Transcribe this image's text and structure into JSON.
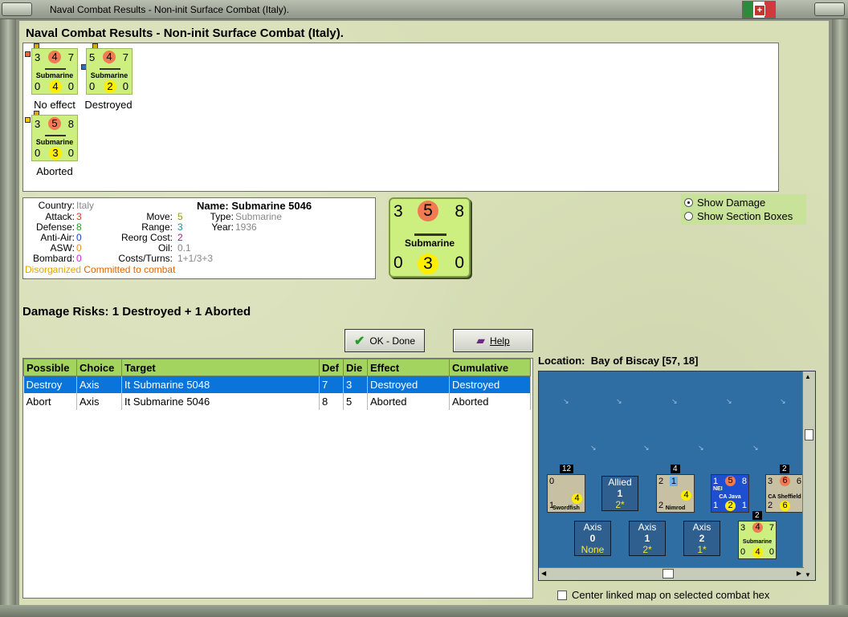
{
  "window": {
    "title": "Naval Combat Results - Non-init Surface Combat (Italy)."
  },
  "header": {
    "title": "Naval Combat Results - Non-init Surface Combat (Italy)."
  },
  "counters": [
    {
      "attack": "3",
      "defense_top": "4",
      "move": "7",
      "name": "Submarine",
      "bl": "0",
      "bc": "4",
      "br": "0",
      "result": "No effect"
    },
    {
      "attack": "5",
      "defense_top": "4",
      "move": "7",
      "name": "Submarine",
      "bl": "0",
      "bc": "2",
      "br": "0",
      "result": "Destroyed"
    },
    {
      "attack": "3",
      "defense_top": "5",
      "move": "8",
      "name": "Submarine",
      "bl": "0",
      "bc": "3",
      "br": "0",
      "result": "Aborted"
    }
  ],
  "info": {
    "country_label": "Country:",
    "country": "Italy",
    "attack_label": "Attack:",
    "attack": "3",
    "defense_label": "Defense:",
    "defense": "8",
    "antiair_label": "Anti-Air:",
    "antiair": "0",
    "asw_label": "ASW:",
    "asw": "0",
    "bombard_label": "Bombard:",
    "bombard": "0",
    "move_label": "Move:",
    "move": "5",
    "range_label": "Range:",
    "range": "3",
    "reorg_label": "Reorg Cost:",
    "reorg": "2",
    "oil_label": "Oil:",
    "oil": "0.1",
    "costs_label": "Costs/Turns:",
    "costs": "1+1/3+3",
    "name_label": "Name:",
    "name": "Submarine 5046",
    "type_label": "Type:",
    "type": "Submarine",
    "year_label": "Year:",
    "year": "1936",
    "status1": "Disorganized",
    "status2": "Committed to combat"
  },
  "big_counter": {
    "tl": "3",
    "tc": "5",
    "tr": "8",
    "name": "Submarine",
    "bl": "0",
    "bc": "3",
    "br": "0"
  },
  "options": {
    "show_damage": "Show Damage",
    "show_sections": "Show Section Boxes"
  },
  "damage": {
    "label": "Damage Risks:",
    "value": "1 Destroyed + 1 Aborted"
  },
  "buttons": {
    "ok": "OK - Done",
    "help": "Help"
  },
  "table": {
    "headers": [
      "Possible",
      "Choice",
      "Target",
      "Def",
      "Die",
      "Effect",
      "Cumulative"
    ],
    "rows": [
      [
        "Destroy",
        "Axis",
        "It Submarine 5048",
        "7",
        "3",
        "Destroyed",
        "Destroyed"
      ],
      [
        "Abort",
        "Axis",
        "It Submarine 5046",
        "8",
        "5",
        "Aborted",
        "Aborted"
      ]
    ]
  },
  "location": {
    "label": "Location:",
    "value": "Bay of Biscay [57, 18]"
  },
  "map": {
    "allied_box": {
      "title": "Allied",
      "value": "1",
      "sub": "2*"
    },
    "axis_boxes": [
      {
        "title": "Axis",
        "value": "0",
        "sub": "None"
      },
      {
        "title": "Axis",
        "value": "1",
        "sub": "2*"
      },
      {
        "title": "Axis",
        "value": "2",
        "sub": "1*"
      }
    ],
    "stacks": [
      "12",
      "4",
      "2",
      "2"
    ],
    "units": [
      {
        "a": "0",
        "b": "",
        "c": "1",
        "d": "4",
        "name": "Swordfish"
      },
      {
        "a": "2",
        "b": "1",
        "c": "2",
        "d": "4",
        "name": "Nimrod"
      },
      {
        "a": "1",
        "rc": "5",
        "b": "8",
        "c": "1",
        "yc": "2",
        "d": "1",
        "name": "CA Java",
        "tag": "NEI"
      },
      {
        "a": "3",
        "rc": "6",
        "b": "6",
        "c": "2",
        "yc": "6",
        "d": "",
        "name": "CA Sheffield"
      },
      {
        "a": "3",
        "rc": "4",
        "b": "7",
        "c": "0",
        "yc": "4",
        "d": "0",
        "name": "Submarine"
      }
    ]
  },
  "center_map": {
    "label": "Center linked map on selected combat hex"
  },
  "colors": {
    "panel": "#d8dfb7",
    "counter": "#ccef7f",
    "header_row": "#a3d45f",
    "selected_row": "#0a74da",
    "sea": "#2f6ea3"
  }
}
